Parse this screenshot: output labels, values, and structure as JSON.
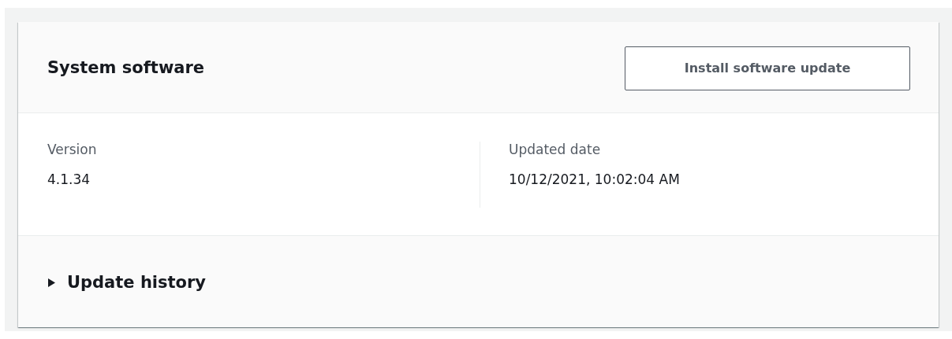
{
  "panel": {
    "title": "System software",
    "action_button": "Install software update"
  },
  "fields": [
    {
      "label": "Version",
      "value": "4.1.34"
    },
    {
      "label": "Updated date",
      "value": "10/12/2021, 10:02:04 AM"
    }
  ],
  "expander": {
    "label": "Update history",
    "expanded": false
  }
}
